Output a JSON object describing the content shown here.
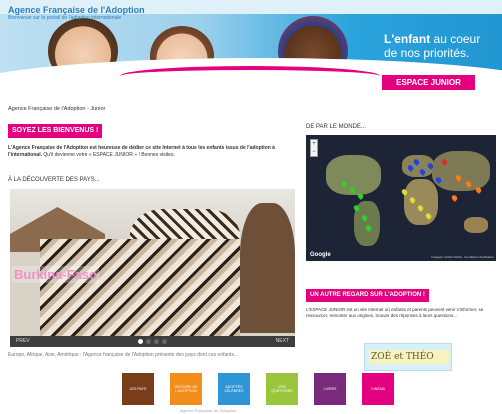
{
  "header": {
    "site_title": "Agence Française de l'Adoption",
    "site_subtitle": "Bienvenue sur le portail de l'adoption internationale",
    "tagline_strong": "L'enfant",
    "tagline_rest": " au coeur de nos priorités.",
    "espace_junior": "ESPACE JUNIOR"
  },
  "breadcrumb": "Agence Française de l'Adoption - Junior",
  "welcome": {
    "title": "SOYEZ LES BIENVENUS !",
    "text_bold": "L'Agence Française de l'Adoption est heureuse de dédier ce site Internet à tous les enfants issus de l'adoption à l'international.",
    "text_rest": " Qu'il devienne votre « ESPACE JUNIOR » ! Bonnes visites."
  },
  "pays": {
    "label": "À LA DÉCOUVERTE DES PAYS...",
    "country": "Burkina-Faso",
    "prev": "PREV",
    "next": "NEXT"
  },
  "bottom_text": "Europe, Afrique, Asie, Amérique : l'Agence française de l'Adoption présente des pays dont ces enfants...",
  "monde": {
    "label": "DE PAR LE MONDE...",
    "zoom_in": "+",
    "zoom_out": "−",
    "google": "Google",
    "credit": "Imagerie ©2014 NASA · Conditions d'utilisation"
  },
  "regard": {
    "title": "UN AUTRE REGARD SUR L'ADOPTION !",
    "text": "L'ESPACE JUNIOR est un site Internet où enfants et parents peuvent venir s'informer, se ressourcer, remonter aux origines, trouver des réponses à leurs questions..."
  },
  "zoe_banner": "ZOÉ et THÉO",
  "nav": [
    {
      "label": "LES PAYS",
      "color": "#7a3d1a"
    },
    {
      "label": "HISTOIRE DE L'ADOPTION",
      "color": "#f28c1a"
    },
    {
      "label": "ADOPTÉS CÉLÈBRES",
      "color": "#2e96d6"
    },
    {
      "label": "VOS QUESTIONS",
      "color": "#9bc53d"
    },
    {
      "label": "LIVRES",
      "color": "#7a2a7a"
    },
    {
      "label": "CINÉMA",
      "color": "#e4007e"
    }
  ],
  "footer": "Agence Française de l'Adoption",
  "colors": {
    "accent_pink": "#e4007e",
    "header_blue": "#2296d2"
  }
}
